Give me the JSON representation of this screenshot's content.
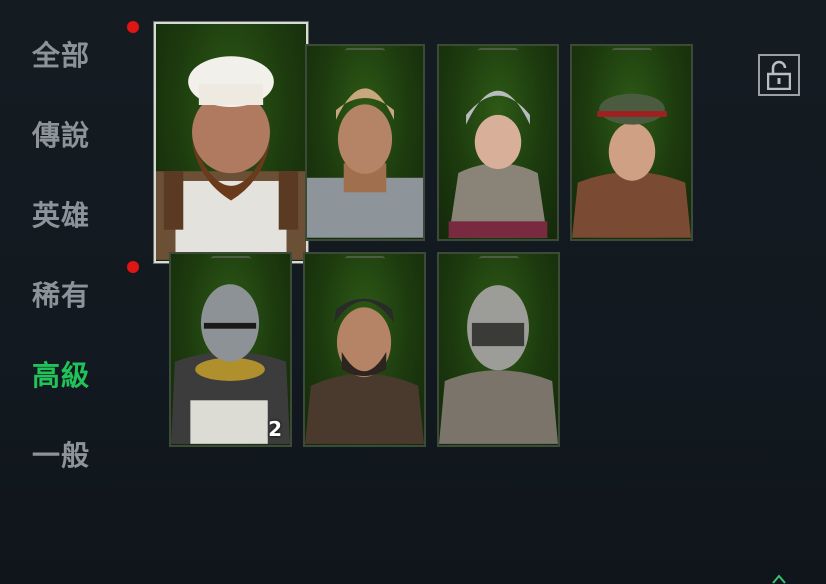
{
  "categories": [
    {
      "label": "全部",
      "badge": true,
      "active": false
    },
    {
      "label": "傳說",
      "badge": false,
      "active": false
    },
    {
      "label": "英雄",
      "badge": false,
      "active": false
    },
    {
      "label": "稀有",
      "badge": true,
      "active": false
    },
    {
      "label": "高級",
      "badge": false,
      "active": true
    },
    {
      "label": "一般",
      "badge": false,
      "active": false
    }
  ],
  "characters": [
    {
      "name": "chef-dwarf",
      "selected": true,
      "count": ""
    },
    {
      "name": "bandana-soldier",
      "selected": false,
      "count": ""
    },
    {
      "name": "chainmail-maiden",
      "selected": false,
      "count": ""
    },
    {
      "name": "cap-youth",
      "selected": false,
      "count": ""
    },
    {
      "name": "visored-knight",
      "selected": false,
      "count": "2"
    },
    {
      "name": "bearded-warrior",
      "selected": false,
      "count": ""
    },
    {
      "name": "steel-helm-guard",
      "selected": false,
      "count": ""
    }
  ],
  "colors": {
    "active_category": "#22c25a",
    "inactive_category": "#8d939a",
    "badge": "#e01616",
    "card_background": "#1f3a12"
  },
  "lock_icon": "unlock-icon"
}
